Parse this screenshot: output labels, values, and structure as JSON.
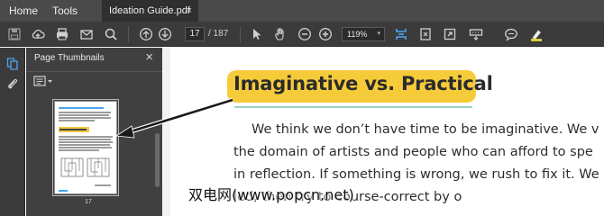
{
  "menu": {
    "home": "Home",
    "tools": "Tools"
  },
  "tab": {
    "title": "Ideation Guide.pdf",
    "close": "×"
  },
  "toolbar": {
    "current_page": "17",
    "page_total": "/ 187",
    "zoom": "119%",
    "zoom_caret": "▾",
    "icons": [
      "save-icon",
      "cloud-upload-icon",
      "print-icon",
      "email-icon",
      "search-icon",
      "page-up-icon",
      "page-down-icon",
      "select-cursor-icon",
      "hand-tool-icon",
      "zoom-out-icon",
      "zoom-in-icon",
      "fit-width-icon",
      "fit-page-icon",
      "full-screen-icon",
      "read-mode-icon",
      "comment-icon",
      "highlight-icon"
    ]
  },
  "panel": {
    "title": "Page Thumbnails",
    "close": "×",
    "thumbnail_page": "17"
  },
  "document": {
    "heading": "Imaginative vs. Practical",
    "lines": [
      "We think we don’t have time to be imaginative. We v",
      "the domain of artists and people who can afford to spe",
      "in reflection. If something is wrong, we rush to fix it. We",
      "                                    led, then try to course-correct by o"
    ]
  },
  "watermark": "双电网(www.popcn.net)",
  "colors": {
    "toolbar_bg": "#3b3b3b",
    "heading_highlight": "#f6cb3a",
    "accent_blue": "#4ea3f0",
    "heading_rule": "#9bd3b8"
  }
}
